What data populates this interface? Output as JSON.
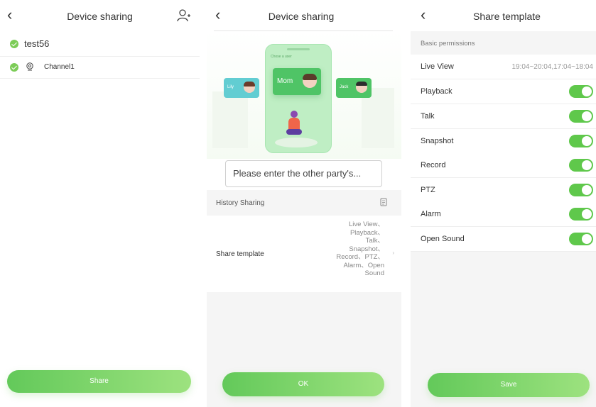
{
  "screen1": {
    "title": "Device sharing",
    "account": "test56",
    "channel": "Channel1",
    "share_button": "Share"
  },
  "screen2": {
    "title": "Device sharing",
    "illustration": {
      "phone_header": "Chose a user",
      "left_user": "Lily",
      "center_user": "Mom",
      "right_user": "Jack"
    },
    "input_placeholder": "Please enter the other party's...",
    "history_label": "History Sharing",
    "share_template_label": "Share template",
    "share_template_value": [
      "Live View、",
      "Playback、",
      "Talk、",
      "Snapshot、",
      "Record、PTZ、",
      "Alarm、Open",
      "Sound"
    ],
    "ok_button": "OK"
  },
  "screen3": {
    "title": "Share template",
    "section": "Basic permissions",
    "live_view": {
      "label": "Live View",
      "value": "19:04~20:04,17:04~18:04"
    },
    "permissions": [
      {
        "label": "Playback",
        "on": true
      },
      {
        "label": "Talk",
        "on": true
      },
      {
        "label": "Snapshot",
        "on": true
      },
      {
        "label": "Record",
        "on": true
      },
      {
        "label": "PTZ",
        "on": true
      },
      {
        "label": "Alarm",
        "on": true
      },
      {
        "label": "Open Sound",
        "on": true
      }
    ],
    "save_button": "Save"
  },
  "colors": {
    "accent_green": "#5fc84b",
    "check_green": "#7ccc57",
    "gradient_light": "#9de27f"
  }
}
